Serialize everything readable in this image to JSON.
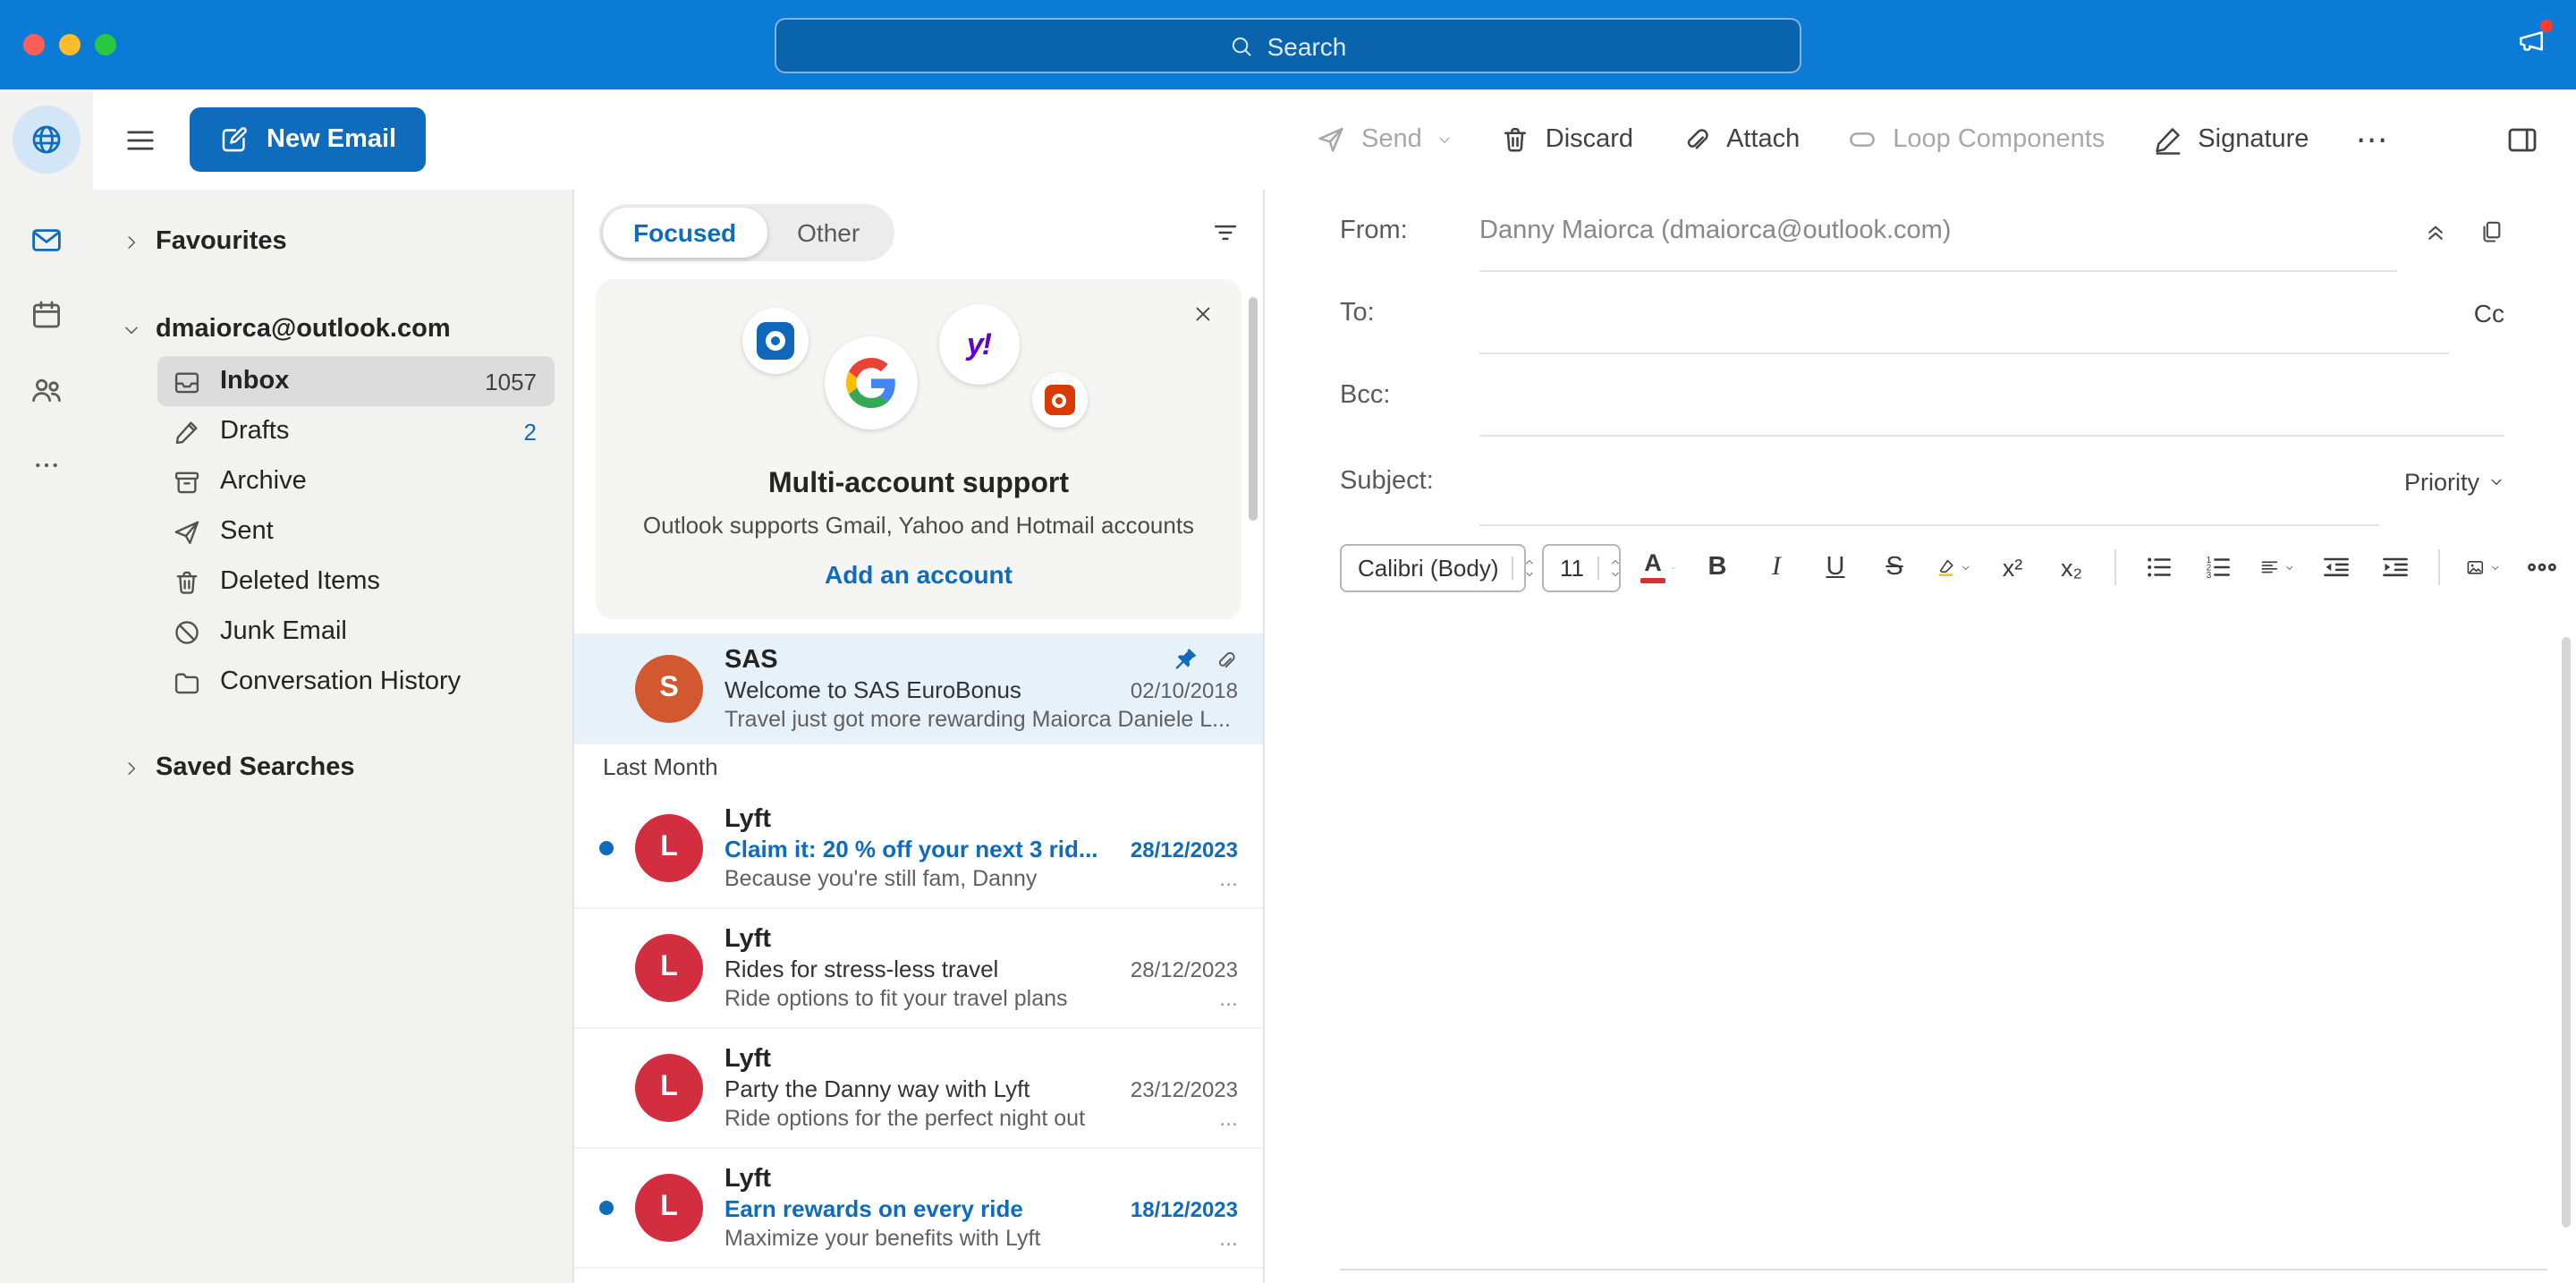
{
  "titlebar": {
    "search_label": "Search"
  },
  "toolbar": {
    "new_email_label": "New Email",
    "send_label": "Send",
    "discard_label": "Discard",
    "attach_label": "Attach",
    "loop_label": "Loop Components",
    "signature_label": "Signature",
    "more_label": "⋯"
  },
  "sidebar": {
    "favourites_label": "Favourites",
    "account_label": "dmaiorca@outlook.com",
    "folders": [
      {
        "label": "Inbox",
        "count": "1057"
      },
      {
        "label": "Drafts",
        "count": "2"
      },
      {
        "label": "Archive",
        "count": ""
      },
      {
        "label": "Sent",
        "count": ""
      },
      {
        "label": "Deleted Items",
        "count": ""
      },
      {
        "label": "Junk Email",
        "count": ""
      },
      {
        "label": "Conversation History",
        "count": ""
      }
    ],
    "saved_searches_label": "Saved Searches"
  },
  "list": {
    "tab_focused": "Focused",
    "tab_other": "Other",
    "promo": {
      "title": "Multi-account support",
      "subtitle": "Outlook supports Gmail, Yahoo and Hotmail accounts",
      "link_label": "Add an account"
    },
    "section_label": "Last Month",
    "emails": [
      {
        "sender": "SAS",
        "avatar": "S",
        "subject": "Welcome to SAS EuroBonus",
        "date": "02/10/2018",
        "preview": "Travel just got more rewarding Maiorca Daniele L...",
        "more": ""
      },
      {
        "sender": "Lyft",
        "avatar": "L",
        "subject": "Claim it: 20 % off your next 3 rid...",
        "date": "28/12/2023",
        "preview": "Because you're still fam, Danny",
        "more": "..."
      },
      {
        "sender": "Lyft",
        "avatar": "L",
        "subject": "Rides for stress-less travel",
        "date": "28/12/2023",
        "preview": "Ride options to fit your travel plans",
        "more": "..."
      },
      {
        "sender": "Lyft",
        "avatar": "L",
        "subject": "Party the Danny way with Lyft",
        "date": "23/12/2023",
        "preview": "Ride options for the perfect night out",
        "more": "..."
      },
      {
        "sender": "Lyft",
        "avatar": "L",
        "subject": "Earn rewards on every ride",
        "date": "18/12/2023",
        "preview": "Maximize your benefits with Lyft",
        "more": "..."
      }
    ]
  },
  "compose": {
    "from_label": "From:",
    "from_value": "Danny Maiorca (dmaiorca@outlook.com)",
    "to_label": "To:",
    "cc_label": "Cc",
    "bcc_label": "Bcc:",
    "subject_label": "Subject:",
    "priority_label": "Priority",
    "format": {
      "font_name": "Calibri (Body)",
      "font_size": "11",
      "font_color_letter": "A",
      "bold": "B",
      "italic": "I",
      "underline": "U",
      "strikethrough": "S",
      "superscript": "x²",
      "subscript": "x₂"
    }
  },
  "colors": {
    "titlebar_blue": "#0c7bd6",
    "accent_blue": "#0f6cbd",
    "unread_blue": "#0f6cbd",
    "avatar_sas": "#d1582f",
    "avatar_lyft": "#d22e3f"
  }
}
